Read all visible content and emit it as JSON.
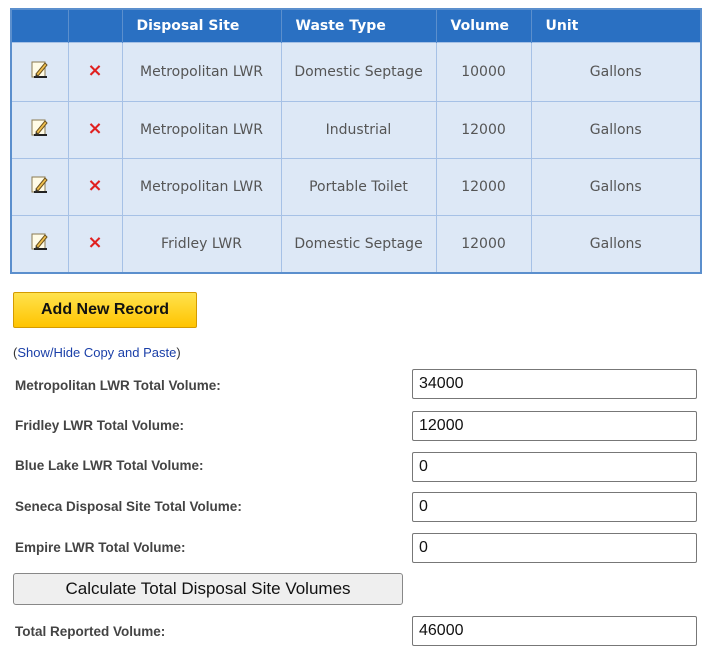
{
  "table": {
    "headers": [
      "",
      "",
      "Disposal Site",
      "Waste Type",
      "Volume",
      "Unit"
    ],
    "rows": [
      {
        "site": "Metropolitan LWR",
        "waste": "Domestic Septage",
        "volume": "10000",
        "unit": "Gallons"
      },
      {
        "site": "Metropolitan LWR",
        "waste": "Industrial",
        "volume": "12000",
        "unit": "Gallons"
      },
      {
        "site": "Metropolitan LWR",
        "waste": "Portable Toilet",
        "volume": "12000",
        "unit": "Gallons"
      },
      {
        "site": "Fridley LWR",
        "waste": "Domestic Septage",
        "volume": "12000",
        "unit": "Gallons"
      }
    ],
    "edit_icon": "edit-pencil-icon",
    "delete_icon": "delete-x-icon",
    "delete_glyph": "×"
  },
  "add_button_label": "Add New Record",
  "copy_paste": {
    "open": "(",
    "link": "Show/Hide Copy and Paste",
    "close": ")"
  },
  "totals": [
    {
      "label": "Metropolitan LWR Total Volume:",
      "value": "34000"
    },
    {
      "label": "Fridley LWR Total Volume:",
      "value": "12000"
    },
    {
      "label": "Blue Lake LWR Total Volume:",
      "value": "0"
    },
    {
      "label": "Seneca Disposal Site Total Volume:",
      "value": "0"
    },
    {
      "label": "Empire LWR Total Volume:",
      "value": "0"
    }
  ],
  "calc_button_label": "Calculate Total Disposal Site Volumes",
  "total_reported": {
    "label": "Total Reported Volume:",
    "value": "46000"
  },
  "colors": {
    "header_bg": "#2a70c2",
    "row_bg": "#dde8f6",
    "add_button": "#ffc400",
    "delete": "#e02020",
    "link": "#1a3fa8"
  }
}
